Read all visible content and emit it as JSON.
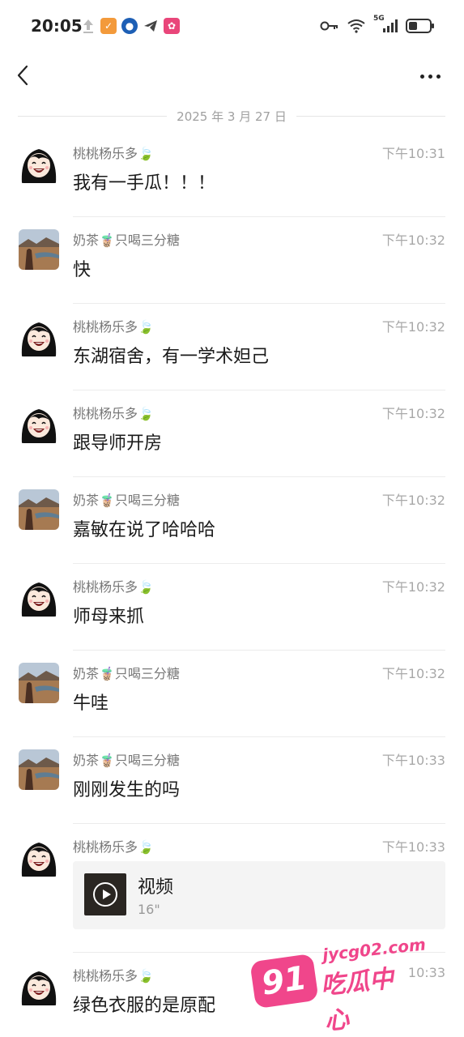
{
  "status_bar": {
    "time": "20:05",
    "network": "5G"
  },
  "nav": {
    "back_icon": "chevron-left-icon",
    "more_icon": "more-dots-icon"
  },
  "date_divider": "2025 年 3 月 27 日",
  "users": {
    "tao": {
      "name": "桃桃杨乐多",
      "emoji": "🍃",
      "avatar_color": "#1a1a1a"
    },
    "nai": {
      "name_prefix": "奶茶",
      "emoji": "🧋",
      "name_suffix": "只喝三分糖",
      "avatar_color": "#6b4a34"
    }
  },
  "messages": [
    {
      "sender": "tao",
      "time": "下午10:31",
      "text": "我有一手瓜！！！"
    },
    {
      "sender": "nai",
      "time": "下午10:32",
      "text": "快"
    },
    {
      "sender": "tao",
      "time": "下午10:32",
      "text": "东湖宿舍，有一学术妲己"
    },
    {
      "sender": "tao",
      "time": "下午10:32",
      "text": "跟导师开房"
    },
    {
      "sender": "nai",
      "time": "下午10:32",
      "text": "嘉敏在说了哈哈哈"
    },
    {
      "sender": "tao",
      "time": "下午10:32",
      "text": "师母来抓"
    },
    {
      "sender": "nai",
      "time": "下午10:32",
      "text": "牛哇"
    },
    {
      "sender": "nai",
      "time": "下午10:33",
      "text": "刚刚发生的吗"
    },
    {
      "sender": "tao",
      "time": "下午10:33",
      "video": {
        "title": "视频",
        "duration": "16\""
      }
    },
    {
      "sender": "tao",
      "time": "10:33",
      "text": "绿色衣服的是原配"
    }
  ],
  "watermark": {
    "badge": "91",
    "url": "jycg02.com",
    "name": "吃瓜中心"
  }
}
